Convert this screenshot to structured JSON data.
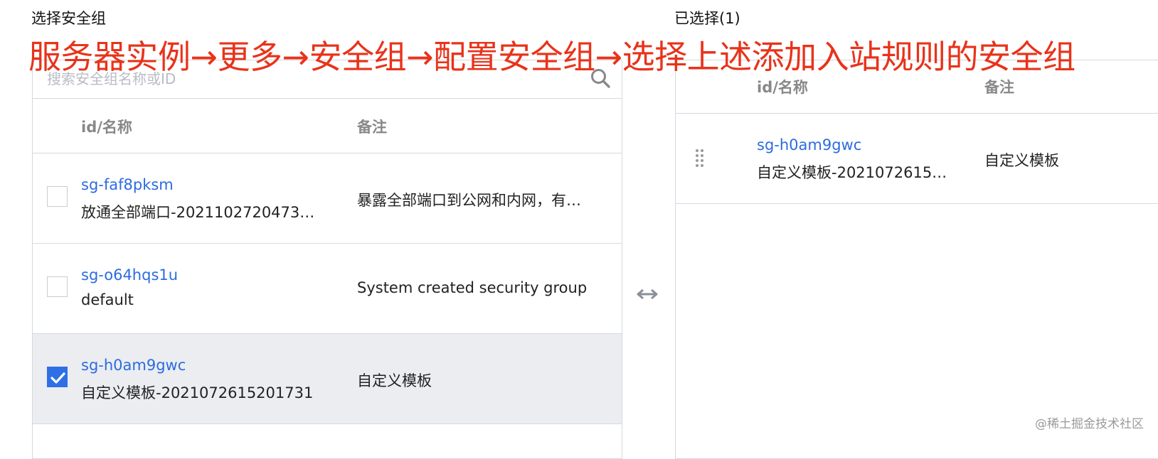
{
  "left_title": "选择安全组",
  "right_title": "已选择(1)",
  "annotation": "服务器实例→更多→安全组→配置安全组→选择上述添加入站规则的安全组",
  "search": {
    "placeholder": "搜索安全组名称或ID",
    "value": ""
  },
  "left_table": {
    "headers": {
      "id_name": "id/名称",
      "remark": "备注"
    },
    "rows": [
      {
        "id": "sg-faf8pksm",
        "name": "放通全部端口-2021102720473…",
        "remark": "暴露全部端口到公网和内网，有…",
        "checked": false
      },
      {
        "id": "sg-o64hqs1u",
        "name": "default",
        "remark": "System created security group",
        "checked": false
      },
      {
        "id": "sg-h0am9gwc",
        "name": "自定义模板-2021072615201731",
        "remark": "自定义模板",
        "checked": true
      }
    ]
  },
  "transfer_icon": "left-right-arrow-icon",
  "right_table": {
    "headers": {
      "id_name": "id/名称",
      "remark": "备注"
    },
    "rows": [
      {
        "id": "sg-h0am9gwc",
        "name": "自定义模板-2021072615…",
        "remark": "自定义模板"
      }
    ]
  },
  "watermark": "@稀土掘金技术社区",
  "colors": {
    "accent": "#2f6fe6",
    "link": "#2b6ce0",
    "annotation": "#e8331a",
    "selected_row": "#ebedf1"
  }
}
